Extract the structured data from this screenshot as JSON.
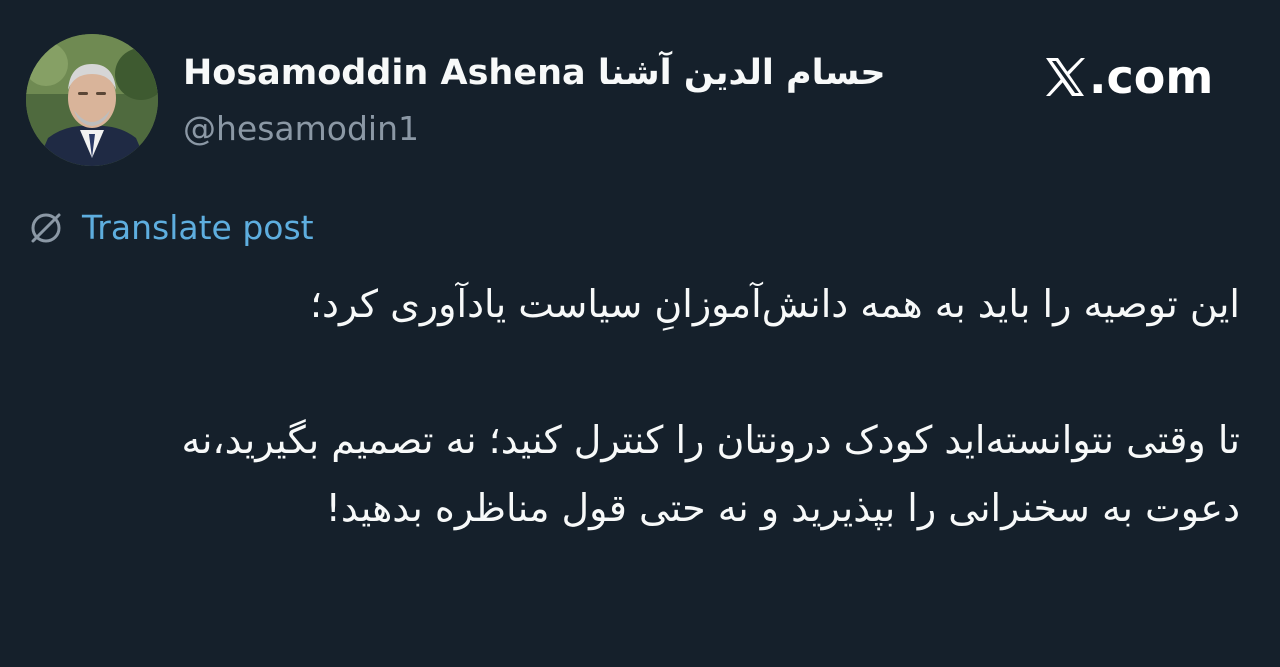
{
  "author": {
    "display_name": "Hosamoddin Ashena حسام الدین آشنا",
    "handle": "@hesamodin1",
    "avatar_icon": "profile-photo"
  },
  "brand": {
    "icon": "x-logo-icon",
    "text": ".com"
  },
  "translate": {
    "icon": "globe-translate-icon",
    "label": "Translate post"
  },
  "tweet": {
    "paragraph_1": "این توصیه را باید به همه دانش‌آموزانِ سیاست یادآوری کرد؛",
    "paragraph_2": "تا وقتی نتوانسته‌اید کودک درونتان را کنترل کنید؛ نه تصمیم بگیرید،نه دعوت به سخنرانی را بپذیرید و نه حتی قول مناظره بدهید!"
  },
  "colors": {
    "background": "#15202b",
    "text_primary": "#f7f9f9",
    "text_secondary": "#8b98a5",
    "link": "#5eaedf"
  }
}
